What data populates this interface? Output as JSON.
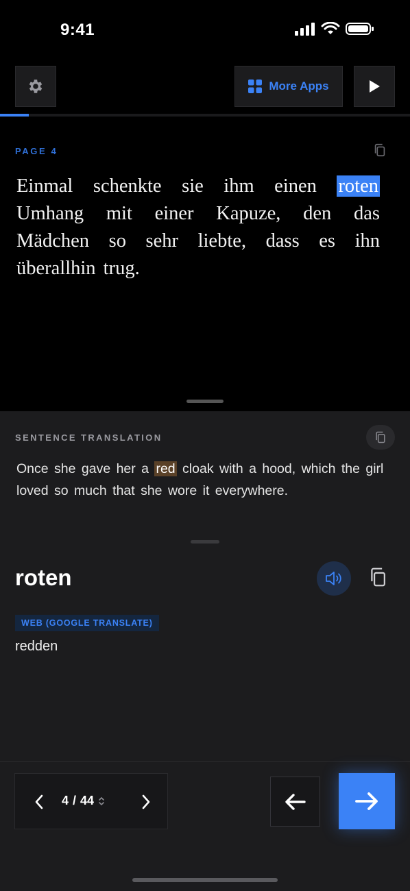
{
  "status": {
    "time": "9:41"
  },
  "toolbar": {
    "more_apps_label": "More Apps"
  },
  "reader": {
    "page_label": "PAGE 4",
    "text_before": "Einmal schenkte sie ihm einen ",
    "highlighted_word": "roten",
    "text_after": " Umhang mit einer Kapuze, den das Mädchen so sehr liebte, dass es ihn überallhin trug."
  },
  "translation": {
    "label": "SENTENCE TRANSLATION",
    "text_before": "Once she gave her a ",
    "highlighted_word": "red",
    "text_after": " cloak with a hood, which the girl loved so much that she wore it everywhere."
  },
  "word": {
    "title": "roten",
    "source_badge": "WEB (GOOGLE TRANSLATE)",
    "meaning": "redden"
  },
  "pager": {
    "current": "4",
    "separator": "/",
    "total": "44"
  },
  "colors": {
    "accent": "#3b82f6",
    "highlight_source": "#3b82f6",
    "highlight_translation": "#5a4128"
  },
  "progress": {
    "fraction": 0.07
  }
}
